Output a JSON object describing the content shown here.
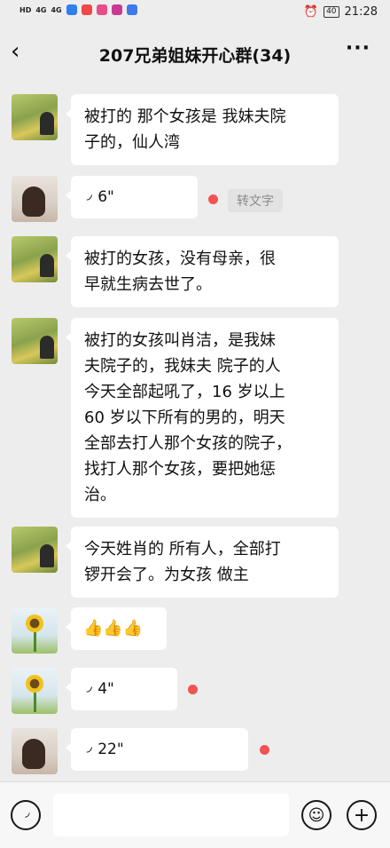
{
  "status_bar": {
    "left_labels": [
      "HD",
      "4G",
      "4G"
    ],
    "battery": "40",
    "time": "21:28"
  },
  "nav": {
    "title": "207兄弟姐妹开心群(34)"
  },
  "messages": [
    {
      "type": "text",
      "text": "被打的 那个女孩是 我妹夫院\n子的，仙人湾"
    },
    {
      "type": "voice",
      "duration": "6\"",
      "convert_label": "转文字"
    },
    {
      "type": "text",
      "text": "被打的女孩，没有母亲，很\n早就生病去世了。"
    },
    {
      "type": "text",
      "text": "被打的女孩叫肖洁，是我妹\n夫院子的，我妹夫 院子的人\n今天全部起吼了，16 岁以上\n60 岁以下所有的男的，明天\n全部去打人那个女孩的院子，\n找打人那个女孩，要把她惩\n治。"
    },
    {
      "type": "text",
      "text": "今天姓肖的 所有人，全部打\n锣开会了。为女孩 做主"
    },
    {
      "type": "emoji",
      "text": "👍👍👍"
    },
    {
      "type": "voice",
      "duration": "4\""
    },
    {
      "type": "voice",
      "duration": "22\""
    }
  ],
  "icons": {
    "back": "chevron-left-icon",
    "more": "more-dots-icon",
    "voice": "voice-wave-icon",
    "emoji": "smiley-icon",
    "add": "plus-circle-icon"
  },
  "colors": {
    "background": "#ededed",
    "bubble": "#ffffff",
    "unread": "#f25353"
  }
}
